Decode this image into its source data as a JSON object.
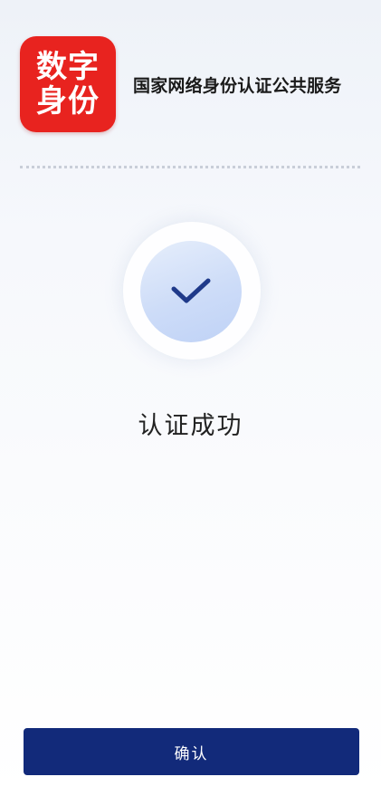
{
  "header": {
    "logo_line1": "数字",
    "logo_line2": "身份",
    "service_name": "国家网络身份认证公共服务"
  },
  "result": {
    "icon": "checkmark-icon",
    "text": "认证成功"
  },
  "footer": {
    "confirm_label": "确认"
  },
  "colors": {
    "logo_red": "#e8231f",
    "button_navy": "#122a7a",
    "check_navy": "#1f3a8a",
    "circle_blue": "#cddcf8"
  }
}
